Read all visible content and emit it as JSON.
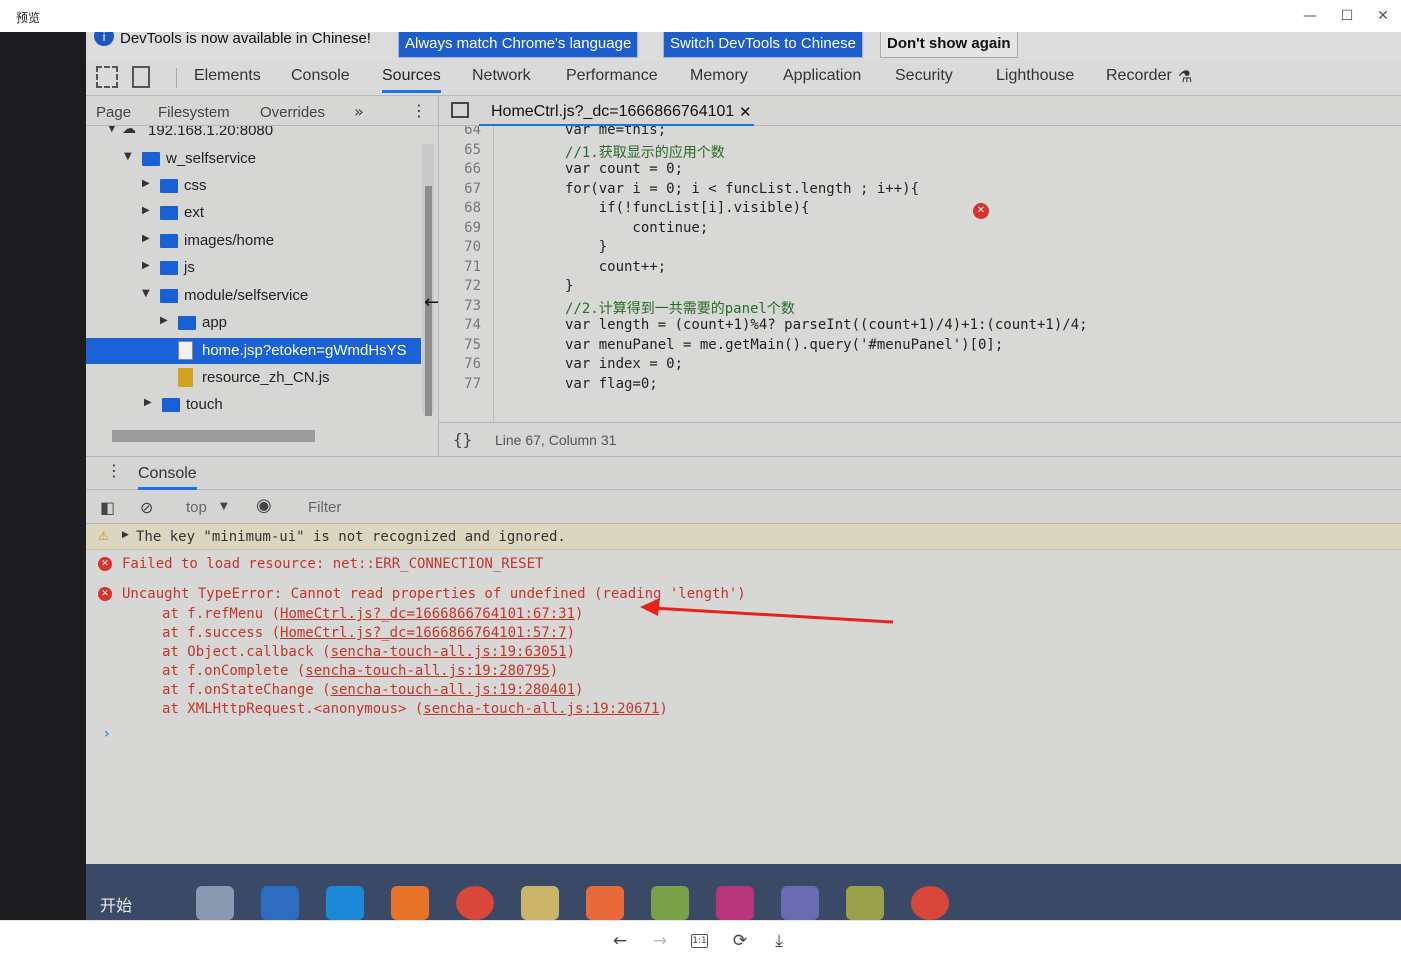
{
  "viewer": {
    "title": "预览",
    "minimize": "—",
    "maximize": "☐",
    "close": "✕",
    "prev": "←",
    "next": "→",
    "actual_size": "1:1",
    "rotate": "⟳",
    "download": "⤓"
  },
  "infobar": {
    "icon": "info-icon",
    "text": "DevTools is now available in Chinese!",
    "btn_match": "Always match Chrome's language",
    "btn_switch": "Switch DevTools to Chinese",
    "btn_dont_show": "Don't show again"
  },
  "main_tabs": [
    "Elements",
    "Console",
    "Sources",
    "Network",
    "Performance",
    "Memory",
    "Application",
    "Security",
    "Lighthouse",
    "Recorder"
  ],
  "active_main_tab": "Sources",
  "navigator": {
    "tabs": [
      "Page",
      "Filesystem",
      "Overrides"
    ],
    "more": "»",
    "kebab": "⋮",
    "tree": [
      {
        "label": "192.168.1.20:8080",
        "type": "origin"
      },
      {
        "label": "w_selfservice",
        "type": "folder"
      },
      {
        "label": "css",
        "type": "folder"
      },
      {
        "label": "ext",
        "type": "folder"
      },
      {
        "label": "images/home",
        "type": "folder"
      },
      {
        "label": "js",
        "type": "folder"
      },
      {
        "label": "module/selfservice",
        "type": "folder"
      },
      {
        "label": "app",
        "type": "folder"
      },
      {
        "label": "home.jsp?etoken=gWmdHsYS",
        "type": "file-doc",
        "selected": true
      },
      {
        "label": "resource_zh_CN.js",
        "type": "file-js"
      },
      {
        "label": "touch",
        "type": "folder"
      }
    ]
  },
  "editor": {
    "tab_label": "HomeCtrl.js?_dc=1666866764101",
    "tab_close": "✕",
    "status_pretty": "{}",
    "status_position": "Line 67, Column 31",
    "lines": [
      {
        "n": "64",
        "code": "var me=this;"
      },
      {
        "n": "65",
        "code": "//1.获取显示的应用个数"
      },
      {
        "n": "66",
        "code": "var count = 0;"
      },
      {
        "n": "67",
        "code": "for(var i = 0; i < funcList.length ; i++){"
      },
      {
        "n": "68",
        "code": "    if(!funcList[i].visible){"
      },
      {
        "n": "69",
        "code": "        continue;"
      },
      {
        "n": "70",
        "code": "    }"
      },
      {
        "n": "71",
        "code": "    count++;"
      },
      {
        "n": "72",
        "code": "}"
      },
      {
        "n": "73",
        "code": "//2.计算得到一共需要的panel个数"
      },
      {
        "n": "74",
        "code": "var length = (count+1)%4? parseInt((count+1)/4)+1:(count+1)/4;"
      },
      {
        "n": "75",
        "code": "var menuPanel = me.getMain().query('#menuPanel')[0];"
      },
      {
        "n": "76",
        "code": "var index = 0;"
      },
      {
        "n": "77",
        "code": "var flag=0;"
      }
    ]
  },
  "drawer": {
    "kebab": "⋮",
    "tab": "Console",
    "context": "top",
    "context_arrow": "▼",
    "filter_placeholder": "Filter"
  },
  "console": {
    "warning": "The key \"minimum-ui\" is not recognized and ignored.",
    "error1": "Failed to load resource: net::ERR_CONNECTION_RESET",
    "error2": "Uncaught TypeError: Cannot read properties of undefined (reading 'length')",
    "stack": [
      {
        "fn": "at f.refMenu (",
        "link": "HomeCtrl.js?_dc=1666866764101:67:31",
        "end": ")"
      },
      {
        "fn": "at f.success (",
        "link": "HomeCtrl.js?_dc=1666866764101:57:7",
        "end": ")"
      },
      {
        "fn": "at Object.callback (",
        "link": "sencha-touch-all.js:19:63051",
        "end": ")"
      },
      {
        "fn": "at f.onComplete (",
        "link": "sencha-touch-all.js:19:280795",
        "end": ")"
      },
      {
        "fn": "at f.onStateChange (",
        "link": "sencha-touch-all.js:19:280401",
        "end": ")"
      },
      {
        "fn": "at XMLHttpRequest.<anonymous> (",
        "link": "sencha-touch-all.js:19:20671",
        "end": ")"
      }
    ],
    "prompt": "›"
  },
  "taskbar": {
    "start": "开始",
    "icons": [
      "tool-icon",
      "terminal-icon",
      "ie-icon",
      "firefox-icon",
      "chrome-icon",
      "notepad-icon",
      "app-icon",
      "folder-icon",
      "database-icon",
      "archive-icon",
      "chart-icon",
      "chrome-active-icon"
    ]
  },
  "colors": {
    "accent": "#1a73e8",
    "error": "#c2362b",
    "info_button": "#1d5ec8"
  }
}
